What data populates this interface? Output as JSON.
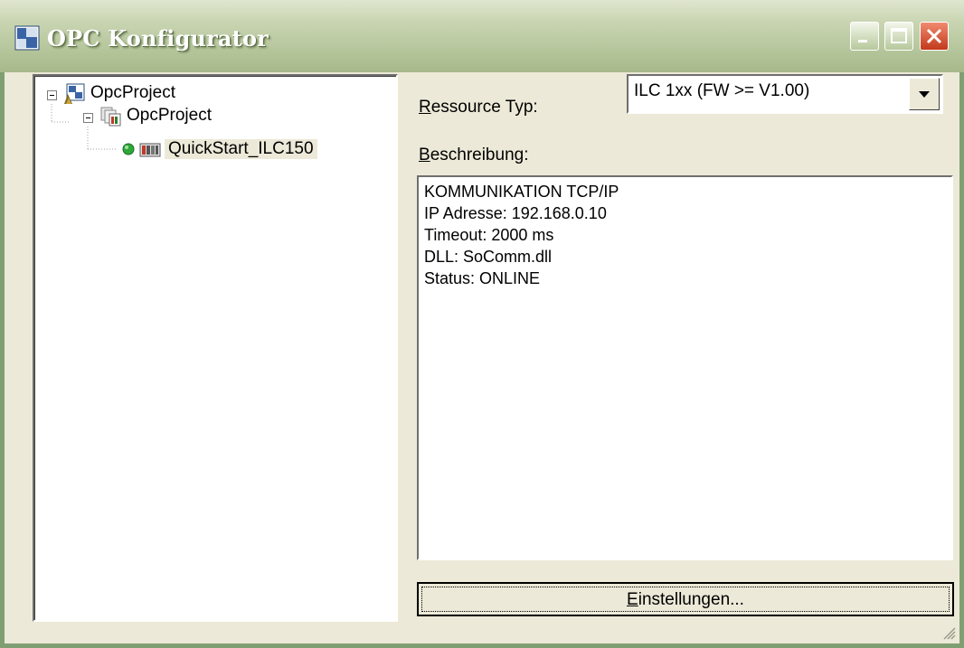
{
  "window": {
    "title": "OPC Konfigurator",
    "icon": "opc-app-icon",
    "controls": [
      "minimize-icon",
      "maximize-icon",
      "close-icon"
    ]
  },
  "tree": {
    "root": {
      "label": "OpcProject",
      "icon": "project-icon",
      "expanded": true
    },
    "child": {
      "label": "OpcProject",
      "icon": "configuration-icon",
      "expanded": true
    },
    "leaf": {
      "label": "QuickStart_ILC150",
      "icon": "resource-icon",
      "status_icon": "online-status-icon",
      "selected": true
    }
  },
  "resource_type": {
    "label_prefix": "R",
    "label_rest": "essource Typ:",
    "value": "ILC 1xx (FW >= V1.00)"
  },
  "description": {
    "label_prefix": "B",
    "label_rest": "eschreibung:",
    "lines": [
      "KOMMUNIKATION TCP/IP",
      "IP Adresse: 192.168.0.10",
      "Timeout: 2000 ms",
      "DLL: SoComm.dll",
      "Status: ONLINE"
    ]
  },
  "settings_button": {
    "label_prefix": "E",
    "label_rest": "instellungen..."
  },
  "colors": {
    "titlebar": "#b5c59b",
    "face": "#ece9d8",
    "close": "#c2391b",
    "status_online": "#2fa83a"
  }
}
